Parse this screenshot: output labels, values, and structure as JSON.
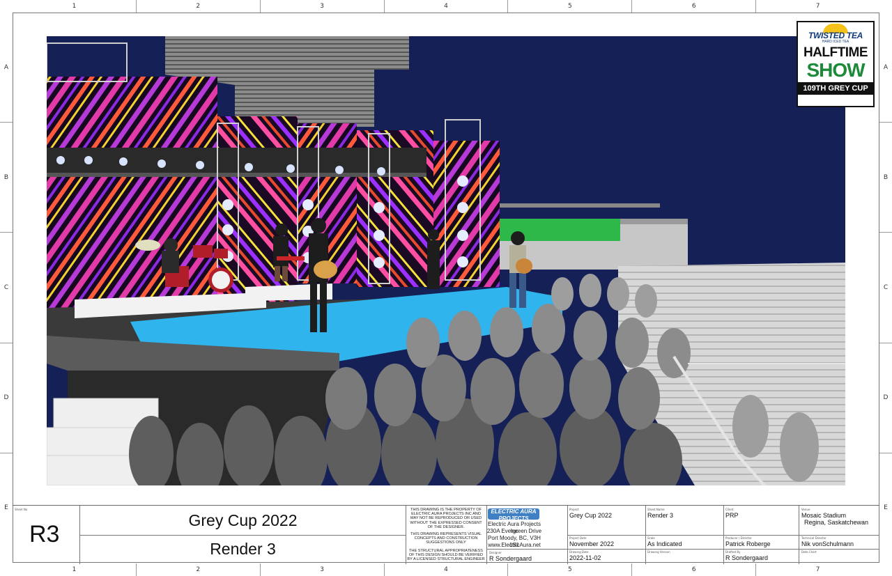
{
  "grid": {
    "columns": [
      "1",
      "2",
      "3",
      "4",
      "5",
      "6",
      "7"
    ],
    "rows": [
      "A",
      "B",
      "C",
      "D",
      "E"
    ]
  },
  "logo": {
    "brand": "TWISTED TEA",
    "brand_sub": "HARD ICED TEA",
    "line1": "HALFTIME",
    "line2": "SHOW",
    "line3": "109TH GREY CUP"
  },
  "title_block": {
    "sheet_no_label": "Sheet No",
    "sheet_no": "R3",
    "title": "Grey Cup 2022",
    "subtitle": "Render 3",
    "notice_1": "THIS DRAWING IS THE PROPERTY OF ELECTRIC AURA PROJECTS INC AND MAY NOT BE REPRODUCED OR USED WITHOUT THE EXPRESSED CONSENT OF THE DESIGNER.",
    "notice_2": "THIS DRAWING REPRESENTS VISUAL CONCEPTS AND CONSTRUCTION SUGGESTIONS ONLY",
    "notice_3": "THE STRUCTURAL APPROPRIATENESS OF THIS DESIGN SHOULD BE VERIFIED BY A LICENSED STRUCTURAL ENGINEER",
    "company_logo": "ELECTRIC AURA PROJECTS",
    "company_name": "Electric Aura Projects Inc",
    "company_addr1": "230A Evergreen Drive",
    "company_addr2": "Port Moody, BC, V3H 1S1",
    "company_web": "www.ElectricAura.net",
    "designer_label": "Designer",
    "designer": "R Sondergaard",
    "project_label": "Project",
    "project": "Grey Cup 2022",
    "project_date_label": "Project Date",
    "project_date": "November 2022",
    "drawing_date_label": "Drawing Date",
    "drawing_date": "2022-11-02",
    "sheet_name_label": "Sheet Name",
    "sheet_name": "Render 3",
    "scale_label": "Scale",
    "scale": "As Indicated",
    "drawing_version_label": "Drawing Version",
    "drawing_version": "",
    "client_label": "Client",
    "client": "PRP",
    "producer_label": "Producer / Director",
    "producer": "Patrick Roberge",
    "drafted_label": "Drafted By",
    "drafted": "R Sondergaard",
    "venue_label": "Venue",
    "venue": "Mosaic Stadium",
    "venue_city": "Regina, Saskatchewan",
    "tech_director_label": "Technical Director",
    "tech_director": "Nik vonSchulmann",
    "date_chart_label": "Date Chart",
    "date_chart": ""
  },
  "colors": {
    "sky": "#152056",
    "dance_floor": "#2fb4ee",
    "screen_pink": "#e23aa8",
    "screen_purple": "#8a2be2",
    "green_board": "#2fb84a",
    "logo_green": "#1d8a3a"
  }
}
